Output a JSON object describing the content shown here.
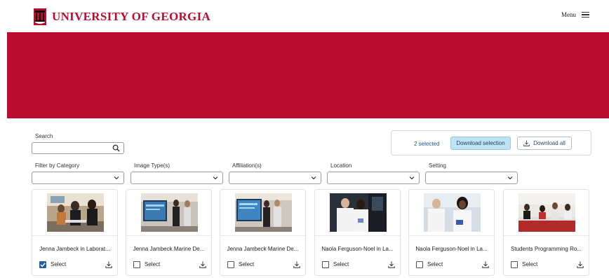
{
  "header": {
    "brand": "UNIVERSITY OF GEORGIA",
    "menu_label": "Menu",
    "logo_icon": "arch-icon",
    "menu_icon": "hamburger-icon"
  },
  "colors": {
    "brand_red": "#ba0c2f",
    "selection_blue": "#bfe3f5",
    "checkbox_blue": "#1f5fa8"
  },
  "search": {
    "label": "Search",
    "value": "",
    "placeholder": ""
  },
  "download": {
    "selected_count_text": "2 selected",
    "selection_button": "Download selection",
    "all_button": "Download all"
  },
  "filters": [
    {
      "label": "Filter by Category",
      "value": ""
    },
    {
      "label": "Image Type(s)",
      "value": ""
    },
    {
      "label": "Affiliation(s)",
      "value": ""
    },
    {
      "label": "Location",
      "value": ""
    },
    {
      "label": "Setting",
      "value": ""
    }
  ],
  "cards": [
    {
      "title": "Jenna Jambeck in Laborat...",
      "select_label": "Select",
      "checked": true
    },
    {
      "title": "Jenna Jambeck Marine De...",
      "select_label": "Select",
      "checked": false
    },
    {
      "title": "Jenna Jambeck Marine De...",
      "select_label": "Select",
      "checked": false
    },
    {
      "title": "Naola Ferguson-Noel in La...",
      "select_label": "Select",
      "checked": false
    },
    {
      "title": "Naola Ferguson-Noel in La...",
      "select_label": "Select",
      "checked": false
    },
    {
      "title": "Students Programming Ro...",
      "select_label": "Select",
      "checked": false
    }
  ]
}
